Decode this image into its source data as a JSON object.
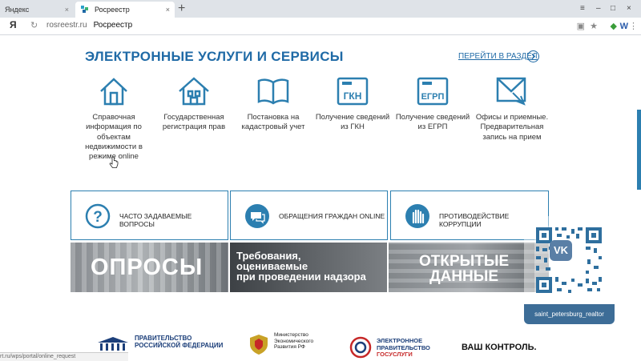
{
  "browser": {
    "tabs": [
      {
        "title": "Яндекс"
      },
      {
        "title": "Росреестр"
      }
    ],
    "address": {
      "domain": "rosreestr.ru",
      "page_title": "Росреестр",
      "yandex_logo": "Я"
    },
    "status_url": "rt.ru/wps/portal/online_request"
  },
  "section": {
    "title": "ЭЛЕКТРОННЫЕ УСЛУГИ И СЕРВИСЫ",
    "link": "ПЕРЕЙТИ В РАЗДЕЛ"
  },
  "services": [
    {
      "icon": "house-icon",
      "label": "Справочная информация по объектам недвижимости в режиме online"
    },
    {
      "icon": "registration-house-icon",
      "label": "Государственная регистрация прав"
    },
    {
      "icon": "book-icon",
      "label": "Постановка на кадастровый учет"
    },
    {
      "icon": "gkn-icon",
      "label": "Получение сведений из ГКН",
      "badge": "ГКН"
    },
    {
      "icon": "egrp-icon",
      "label": "Получение сведений из ЕГРП",
      "badge": "ЕГРП"
    },
    {
      "icon": "offices-icon",
      "label": "Офисы и приемные. Предварительная запись на прием"
    }
  ],
  "info_boxes": [
    {
      "icon": "question-icon",
      "label": "ЧАСТО ЗАДАВАЕМЫЕ ВОПРОСЫ"
    },
    {
      "icon": "chat-icon",
      "label": "ОБРАЩЕНИЯ ГРАЖДАН ONLINE"
    },
    {
      "icon": "hand-icon",
      "label": "ПРОТИВОДЕЙСТВИЕ КОРРУПЦИИ"
    }
  ],
  "banners": [
    {
      "text": "ОПРОСЫ"
    },
    {
      "line1": "Требования,",
      "line2": "оцениваемые",
      "line3": "при проведении надзора"
    },
    {
      "line1": "ОТКРЫТЫЕ",
      "line2": "ДАННЫЕ"
    }
  ],
  "overlay": {
    "vk_logo": "VK",
    "username": "saint_petersburg_realtor"
  },
  "footer_logos": [
    {
      "line1": "ПРАВИТЕЛЬСТВО",
      "line2": "РОССИЙСКОЙ ФЕДЕРАЦИИ"
    },
    {
      "line1": "Министерство",
      "line2": "Экономического",
      "line3": "Развития РФ"
    },
    {
      "line1": "ЭЛЕКТРОННОЕ",
      "line2": "ПРАВИТЕЛЬСТВО",
      "line3": "ГОСУСЛУГИ"
    },
    {
      "text": "ВАШ КОНТРОЛЬ."
    }
  ],
  "colors": {
    "accent": "#1f6aa6",
    "border": "#2c7fb0"
  }
}
